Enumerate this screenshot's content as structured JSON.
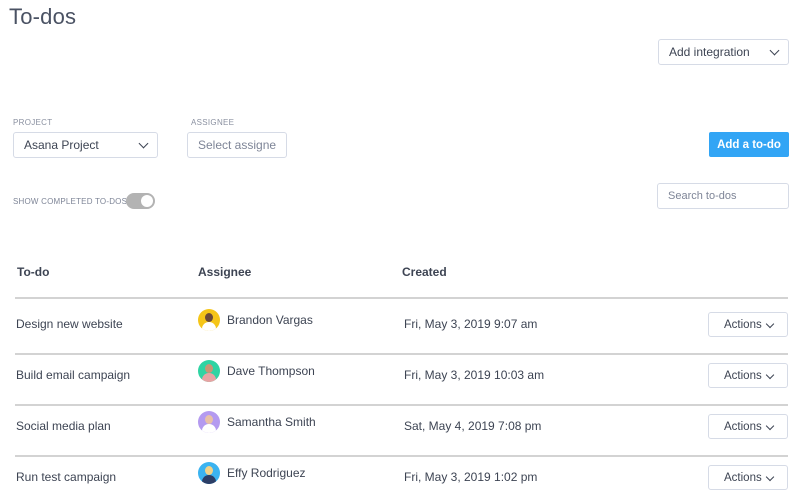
{
  "header": {
    "title": "To-dos",
    "integration_select": {
      "value": "Add integration",
      "icon": "chevron-down-icon"
    }
  },
  "filters": {
    "project": {
      "label": "PROJECT",
      "value": "Asana Project",
      "icon": "chevron-down-icon"
    },
    "assignee": {
      "label": "ASSIGNEE",
      "placeholder": "Select assignee",
      "value": ""
    },
    "add_button": "Add a to-do",
    "show_completed": {
      "label": "SHOW COMPLETED TO-DOS",
      "enabled": true
    },
    "search": {
      "placeholder": "Search to-dos",
      "value": ""
    }
  },
  "table": {
    "columns": [
      "To-do",
      "Assignee",
      "Created"
    ],
    "rows": [
      {
        "todo": "Design new website",
        "assignee": "Brandon Vargas",
        "avatar_color": "#f5c518",
        "created": "Fri, May 3, 2019 9:07 am",
        "action": "Actions"
      },
      {
        "todo": "Build email campaign",
        "assignee": "Dave Thompson",
        "avatar_color": "#2fd4a3",
        "created": "Fri, May 3, 2019 10:03 am",
        "action": "Actions"
      },
      {
        "todo": "Social media plan",
        "assignee": "Samantha Smith",
        "avatar_color": "#b49af0",
        "created": "Sat, May 4, 2019 7:08 pm",
        "action": "Actions"
      },
      {
        "todo": "Run test campaign",
        "assignee": "Effy Rodriguez",
        "avatar_color": "#3bb3f0",
        "created": "Fri, May 3, 2019 1:02 pm",
        "action": "Actions"
      }
    ]
  },
  "colors": {
    "primary": "#32a5f5",
    "text": "#3d4453",
    "border": "#d6dbe6",
    "toggle_track": "#b3b3b3"
  }
}
